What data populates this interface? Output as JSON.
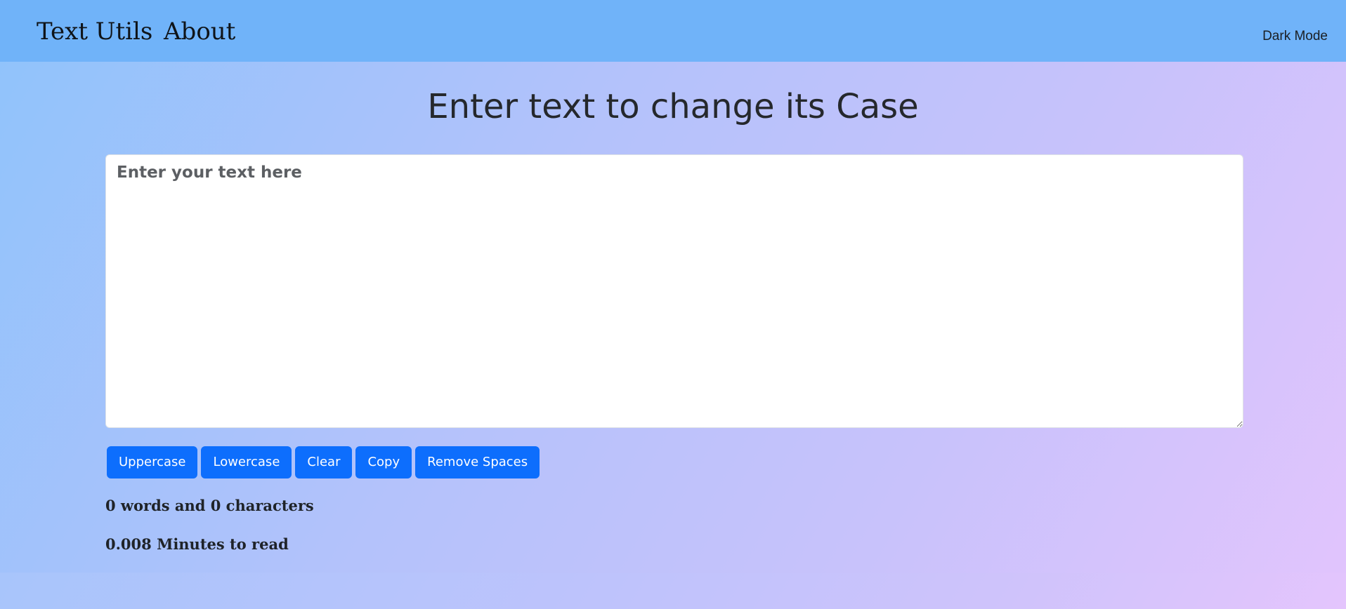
{
  "navbar": {
    "brand": "Text Utils",
    "about_label": "About",
    "dark_mode_label": "Dark Mode"
  },
  "main": {
    "title": "Enter text to change its Case",
    "textarea": {
      "value": "",
      "placeholder": "Enter your text here"
    },
    "buttons": {
      "uppercase": "Uppercase",
      "lowercase": "Lowercase",
      "clear": "Clear",
      "copy": "Copy",
      "remove_spaces": "Remove Spaces"
    },
    "summary": {
      "words_chars": "0 words and 0 characters",
      "read_time": "0.008 Minutes to read"
    }
  },
  "colors": {
    "navbar_bg": "#70b3f9",
    "button_bg": "#0d6efd",
    "gradient_start": "#8fc3fb",
    "gradient_end": "#e2c4fd"
  }
}
